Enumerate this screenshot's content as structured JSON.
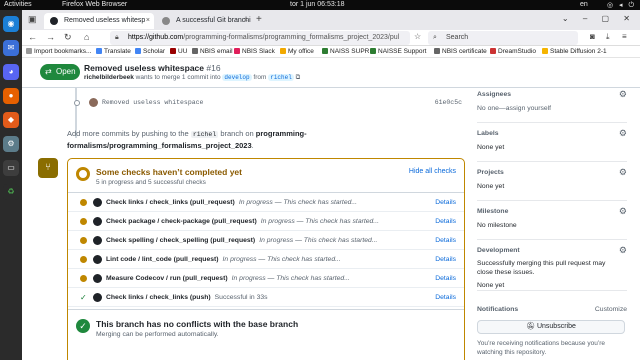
{
  "system": {
    "activities": "Activities",
    "app_name": "Firefox Web Browser",
    "clock": "tor 1 jun  06:53:18",
    "lang": "en"
  },
  "browser": {
    "tabs": [
      {
        "label": "Removed useless whitesp"
      },
      {
        "label": "A successful Git branchi"
      }
    ],
    "url_host": "https://github.com",
    "url_path": "/programming-formalisms/programming_formalisms_project_2023/pul",
    "search_placeholder": "Search",
    "bookmarks": [
      "Import bookmarks...",
      "Translate",
      "Scholar",
      "UU",
      "NBIS email",
      "NBIS Slack",
      "My office",
      "NAISS SUPR",
      "NAISSE Support",
      "NBIS certificate",
      "DreamStudio",
      "Stable Diffusion 2-1"
    ]
  },
  "pr": {
    "state": "Open",
    "title": "Removed useless whitespace",
    "number": "#16",
    "author": "richelbilderbeek",
    "action_text": "wants to merge 1 commit into",
    "base_branch": "develop",
    "from_text": "from",
    "head_branch": "richel"
  },
  "timeline": {
    "commit_message": "Removed useless whitespace",
    "commit_sha": "61e0c5c",
    "add_more_1": "Add more commits by pushing to the",
    "add_more_branch": "richel",
    "add_more_2": "branch on",
    "add_more_repo": "programming-formalisms/programming_formalisms_project_2023",
    "add_more_end": "."
  },
  "checks": {
    "title": "Some checks haven’t completed yet",
    "subtitle": "5 in progress and 5 successful checks",
    "hide_label": "Hide all checks",
    "rows": [
      {
        "name": "Check links / check_links (pull_request)",
        "desc": "In progress — This check has started...",
        "details": "Details",
        "status": "pending"
      },
      {
        "name": "Check package / check-package (pull_request)",
        "desc": "In progress — This check has started...",
        "details": "Details",
        "status": "pending"
      },
      {
        "name": "Check spelling / check_spelling (pull_request)",
        "desc": "In progress — This check has started...",
        "details": "Details",
        "status": "pending"
      },
      {
        "name": "Lint code / lint_code (pull_request)",
        "desc": "In progress — This check has started...",
        "details": "Details",
        "status": "pending"
      },
      {
        "name": "Measure Codecov / run (pull_request)",
        "desc": "In progress — This check has started...",
        "details": "Details",
        "status": "pending"
      },
      {
        "name": "Check links / check_links (push)",
        "desc": "Successful in 33s",
        "details": "Details",
        "status": "success"
      }
    ]
  },
  "merge": {
    "title": "This branch has no conflicts with the base branch",
    "subtitle": "Merging can be performed automatically."
  },
  "sidebar": {
    "assignees_label": "Assignees",
    "assignees_value": "No one—",
    "assign_yourself": "assign yourself",
    "labels_label": "Labels",
    "labels_value": "None yet",
    "projects_label": "Projects",
    "projects_value": "None yet",
    "milestone_label": "Milestone",
    "milestone_value": "No milestone",
    "development_label": "Development",
    "development_text": "Successfully merging this pull request may close these issues.",
    "development_value": "None yet",
    "notifications_label": "Notifications",
    "customize_label": "Customize",
    "unsubscribe_label": "Unsubscribe",
    "notif_note": "You’re receiving notifications because you’re watching this repository."
  }
}
